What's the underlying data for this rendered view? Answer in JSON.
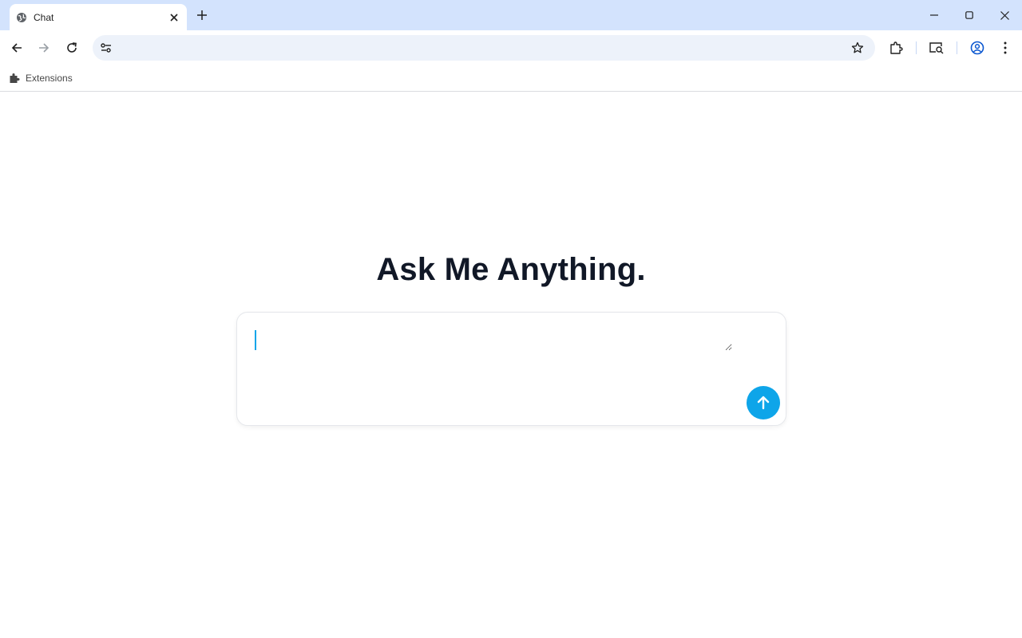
{
  "browser": {
    "tab": {
      "title": "Chat",
      "favicon": "globe-icon"
    },
    "new_tab_icon": "plus-icon",
    "window_controls": [
      "minimize-icon",
      "maximize-icon",
      "close-icon"
    ],
    "omnibox": {
      "value": "",
      "placeholder": ""
    },
    "bookmarks": [
      {
        "label": "Extensions",
        "icon": "puzzle-icon"
      }
    ]
  },
  "page": {
    "heading": "Ask Me Anything.",
    "chat_input": {
      "value": "",
      "placeholder": ""
    },
    "send_icon": "arrow-up-icon"
  },
  "colors": {
    "accent": "#0ea5e9",
    "heading": "#111827",
    "tabstrip": "#d3e3fd",
    "omnibox": "#edf2fa"
  }
}
